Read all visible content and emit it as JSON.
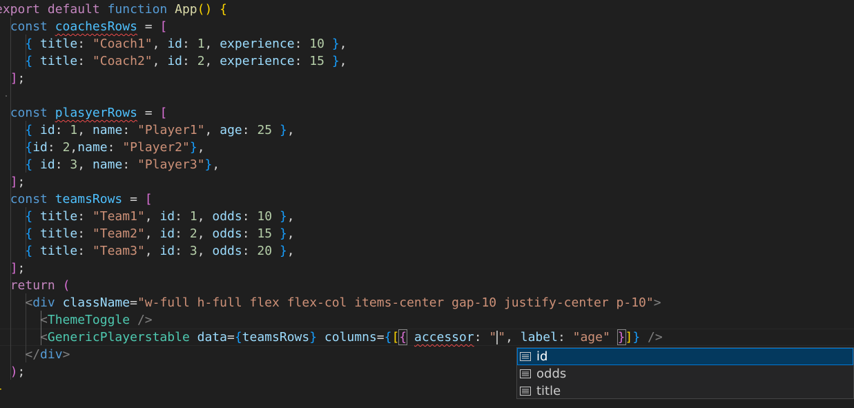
{
  "editor": {
    "lines": [
      [
        [
          "kw2",
          "export"
        ],
        [
          "",
          "&nbsp;"
        ],
        [
          "kw2",
          "default"
        ],
        [
          "",
          "&nbsp;"
        ],
        [
          "kw",
          "function"
        ],
        [
          "",
          "&nbsp;"
        ],
        [
          "fn",
          "App"
        ],
        [
          "b1",
          "()"
        ],
        [
          "",
          "&nbsp;"
        ],
        [
          "b1",
          "{"
        ]
      ],
      [
        [
          "",
          "  "
        ],
        [
          "kw",
          "const"
        ],
        [
          "",
          "&nbsp;"
        ],
        [
          "cst squig",
          "coachesRows"
        ],
        [
          "",
          "&nbsp;=&nbsp;"
        ],
        [
          "b2",
          "["
        ]
      ],
      [
        [
          "",
          "    "
        ],
        [
          "b3",
          "{"
        ],
        [
          "",
          "&nbsp;"
        ],
        [
          "var",
          "title"
        ],
        [
          "",
          ":&nbsp;"
        ],
        [
          "str",
          "\"Coach1\""
        ],
        [
          "",
          ",&nbsp;"
        ],
        [
          "var",
          "id"
        ],
        [
          "",
          ":&nbsp;"
        ],
        [
          "num",
          "1"
        ],
        [
          "",
          ",&nbsp;"
        ],
        [
          "var",
          "experience"
        ],
        [
          "",
          ":&nbsp;"
        ],
        [
          "num",
          "10"
        ],
        [
          "",
          "&nbsp;"
        ],
        [
          "b3",
          "}"
        ],
        [
          "",
          ","
        ]
      ],
      [
        [
          "",
          "    "
        ],
        [
          "b3",
          "{"
        ],
        [
          "",
          "&nbsp;"
        ],
        [
          "var",
          "title"
        ],
        [
          "",
          ":&nbsp;"
        ],
        [
          "str",
          "\"Coach2\""
        ],
        [
          "",
          ",&nbsp;"
        ],
        [
          "var",
          "id"
        ],
        [
          "",
          ":&nbsp;"
        ],
        [
          "num",
          "2"
        ],
        [
          "",
          ",&nbsp;"
        ],
        [
          "var",
          "experience"
        ],
        [
          "",
          ":&nbsp;"
        ],
        [
          "num",
          "15"
        ],
        [
          "",
          "&nbsp;"
        ],
        [
          "b3",
          "}"
        ],
        [
          "",
          ","
        ]
      ],
      [
        [
          "",
          "  "
        ],
        [
          "b2",
          "]"
        ],
        [
          "",
          ";"
        ]
      ],
      [],
      [
        [
          "",
          "  "
        ],
        [
          "kw",
          "const"
        ],
        [
          "",
          "&nbsp;"
        ],
        [
          "cst squig",
          "plasyerRows"
        ],
        [
          "",
          "&nbsp;=&nbsp;"
        ],
        [
          "b2",
          "["
        ]
      ],
      [
        [
          "",
          "    "
        ],
        [
          "b3",
          "{"
        ],
        [
          "",
          "&nbsp;"
        ],
        [
          "var",
          "id"
        ],
        [
          "",
          ":&nbsp;"
        ],
        [
          "num",
          "1"
        ],
        [
          "",
          ",&nbsp;"
        ],
        [
          "var",
          "name"
        ],
        [
          "",
          ":&nbsp;"
        ],
        [
          "str",
          "\"Player1\""
        ],
        [
          "",
          ",&nbsp;"
        ],
        [
          "var",
          "age"
        ],
        [
          "",
          ":&nbsp;"
        ],
        [
          "num",
          "25"
        ],
        [
          "",
          "&nbsp;"
        ],
        [
          "b3",
          "}"
        ],
        [
          "",
          ","
        ]
      ],
      [
        [
          "",
          "    "
        ],
        [
          "b3",
          "{"
        ],
        [
          "var",
          "id"
        ],
        [
          "",
          ":&nbsp;"
        ],
        [
          "num",
          "2"
        ],
        [
          "",
          ","
        ],
        [
          "var",
          "name"
        ],
        [
          "",
          ":&nbsp;"
        ],
        [
          "str",
          "\"Player2\""
        ],
        [
          "b3",
          "}"
        ],
        [
          "",
          ","
        ]
      ],
      [
        [
          "",
          "    "
        ],
        [
          "b3",
          "{"
        ],
        [
          "",
          "&nbsp;"
        ],
        [
          "var",
          "id"
        ],
        [
          "",
          ":&nbsp;"
        ],
        [
          "num",
          "3"
        ],
        [
          "",
          ",&nbsp;"
        ],
        [
          "var",
          "name"
        ],
        [
          "",
          ":&nbsp;"
        ],
        [
          "str",
          "\"Player3\""
        ],
        [
          "b3",
          "}"
        ],
        [
          "",
          ","
        ]
      ],
      [
        [
          "",
          "  "
        ],
        [
          "b2",
          "]"
        ],
        [
          "",
          ";"
        ]
      ],
      [
        [
          "",
          "  "
        ],
        [
          "kw",
          "const"
        ],
        [
          "",
          "&nbsp;"
        ],
        [
          "cst",
          "teamsRows"
        ],
        [
          "",
          "&nbsp;=&nbsp;"
        ],
        [
          "b2",
          "["
        ]
      ],
      [
        [
          "",
          "    "
        ],
        [
          "b3",
          "{"
        ],
        [
          "",
          "&nbsp;"
        ],
        [
          "var",
          "title"
        ],
        [
          "",
          ":&nbsp;"
        ],
        [
          "str",
          "\"Team1\""
        ],
        [
          "",
          ",&nbsp;"
        ],
        [
          "var",
          "id"
        ],
        [
          "",
          ":&nbsp;"
        ],
        [
          "num",
          "1"
        ],
        [
          "",
          ",&nbsp;"
        ],
        [
          "var",
          "odds"
        ],
        [
          "",
          ":&nbsp;"
        ],
        [
          "num",
          "10"
        ],
        [
          "",
          "&nbsp;"
        ],
        [
          "b3",
          "}"
        ],
        [
          "",
          ","
        ]
      ],
      [
        [
          "",
          "    "
        ],
        [
          "b3",
          "{"
        ],
        [
          "",
          "&nbsp;"
        ],
        [
          "var",
          "title"
        ],
        [
          "",
          ":&nbsp;"
        ],
        [
          "str",
          "\"Team2\""
        ],
        [
          "",
          ",&nbsp;"
        ],
        [
          "var",
          "id"
        ],
        [
          "",
          ":&nbsp;"
        ],
        [
          "num",
          "2"
        ],
        [
          "",
          ",&nbsp;"
        ],
        [
          "var",
          "odds"
        ],
        [
          "",
          ":&nbsp;"
        ],
        [
          "num",
          "15"
        ],
        [
          "",
          "&nbsp;"
        ],
        [
          "b3",
          "}"
        ],
        [
          "",
          ","
        ]
      ],
      [
        [
          "",
          "    "
        ],
        [
          "b3",
          "{"
        ],
        [
          "",
          "&nbsp;"
        ],
        [
          "var",
          "title"
        ],
        [
          "",
          ":&nbsp;"
        ],
        [
          "str",
          "\"Team3\""
        ],
        [
          "",
          ",&nbsp;"
        ],
        [
          "var",
          "id"
        ],
        [
          "",
          ":&nbsp;"
        ],
        [
          "num",
          "3"
        ],
        [
          "",
          ",&nbsp;"
        ],
        [
          "var",
          "odds"
        ],
        [
          "",
          ":&nbsp;"
        ],
        [
          "num",
          "20"
        ],
        [
          "",
          "&nbsp;"
        ],
        [
          "b3",
          "}"
        ],
        [
          "",
          ","
        ]
      ],
      [
        [
          "",
          "  "
        ],
        [
          "b2",
          "]"
        ],
        [
          "",
          ";"
        ]
      ],
      [
        [
          "",
          "  "
        ],
        [
          "kw2",
          "return"
        ],
        [
          "",
          "&nbsp;"
        ],
        [
          "b2",
          "("
        ]
      ],
      [
        [
          "",
          "    "
        ],
        [
          "tag",
          "&lt;"
        ],
        [
          "kw",
          "div"
        ],
        [
          "",
          "&nbsp;"
        ],
        [
          "attr",
          "className"
        ],
        [
          "",
          "="
        ],
        [
          "str",
          "\"w-full h-full flex flex-col items-center gap-10 justify-center p-10\""
        ],
        [
          "tag",
          "&gt;"
        ]
      ],
      [
        [
          "",
          "      "
        ],
        [
          "tag",
          "&lt;"
        ],
        [
          "comp",
          "ThemeToggle"
        ],
        [
          "",
          "&nbsp;"
        ],
        [
          "tag",
          "/&gt;"
        ]
      ],
      [
        [
          "",
          "      "
        ],
        [
          "tag",
          "&lt;"
        ],
        [
          "comp",
          "GenericPlayerstable"
        ],
        [
          "",
          "&nbsp;"
        ],
        [
          "attr",
          "data"
        ],
        [
          "",
          "="
        ],
        [
          "b3",
          "{"
        ],
        [
          "var",
          "teamsRows"
        ],
        [
          "b3",
          "}"
        ],
        [
          "",
          "&nbsp;"
        ],
        [
          "attr",
          "columns"
        ],
        [
          "",
          "="
        ],
        [
          "b3",
          "{"
        ],
        [
          "b1",
          "["
        ],
        [
          "b2 bracket-match",
          "{"
        ],
        [
          "",
          "&nbsp;"
        ],
        [
          "var squig",
          "accessor"
        ],
        [
          "",
          ":&nbsp;"
        ],
        [
          "str",
          "\""
        ],
        [
          "cursor",
          ""
        ],
        [
          "str",
          "\""
        ],
        [
          "",
          ",&nbsp;"
        ],
        [
          "var",
          "label"
        ],
        [
          "",
          ":&nbsp;"
        ],
        [
          "str",
          "\"age\""
        ],
        [
          "",
          "&nbsp;"
        ],
        [
          "b2 bracket-match",
          "}"
        ],
        [
          "b1",
          "]"
        ],
        [
          "b3",
          "}"
        ],
        [
          "",
          "&nbsp;"
        ],
        [
          "tag",
          "/&gt;"
        ]
      ],
      [
        [
          "",
          "    "
        ],
        [
          "tag",
          "&lt;/"
        ],
        [
          "kw",
          "div"
        ],
        [
          "tag",
          "&gt;"
        ]
      ],
      [
        [
          "",
          "  "
        ],
        [
          "b2",
          ")"
        ],
        [
          "",
          ";"
        ]
      ],
      [
        [
          "b1",
          "}"
        ]
      ]
    ]
  },
  "suggest": {
    "items": [
      {
        "label": "id",
        "selected": true
      },
      {
        "label": "odds",
        "selected": false
      },
      {
        "label": "title",
        "selected": false
      }
    ]
  }
}
